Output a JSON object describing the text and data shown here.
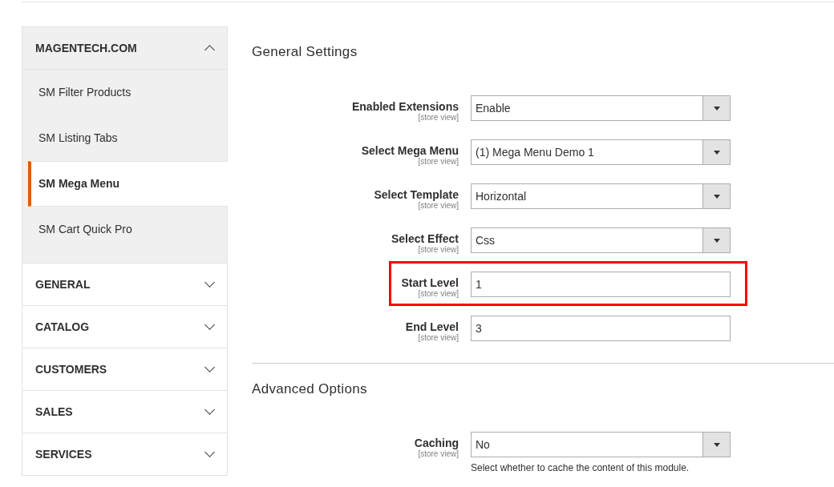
{
  "sidebar": {
    "groups": [
      {
        "label": "MAGENTECH.COM",
        "expanded": true,
        "children": [
          {
            "label": "SM Filter Products",
            "selected": false
          },
          {
            "label": "SM Listing Tabs",
            "selected": false
          },
          {
            "label": "SM Mega Menu",
            "selected": true
          },
          {
            "label": "SM Cart Quick Pro",
            "selected": false
          }
        ]
      },
      {
        "label": "GENERAL",
        "expanded": false
      },
      {
        "label": "CATALOG",
        "expanded": false
      },
      {
        "label": "CUSTOMERS",
        "expanded": false
      },
      {
        "label": "SALES",
        "expanded": false
      },
      {
        "label": "SERVICES",
        "expanded": false
      }
    ]
  },
  "sections": [
    {
      "title": "General Settings",
      "fields": [
        {
          "kind": "select",
          "label": "Enabled Extensions",
          "scope": "[store view]",
          "value": "Enable",
          "highlighted": false
        },
        {
          "kind": "select",
          "label": "Select Mega Menu",
          "scope": "[store view]",
          "value": "(1) Mega Menu Demo 1",
          "highlighted": false
        },
        {
          "kind": "select",
          "label": "Select Template",
          "scope": "[store view]",
          "value": "Horizontal",
          "highlighted": false
        },
        {
          "kind": "select",
          "label": "Select Effect",
          "scope": "[store view]",
          "value": "Css",
          "highlighted": false
        },
        {
          "kind": "text",
          "label": "Start Level",
          "scope": "[store view]",
          "value": "1",
          "highlighted": true
        },
        {
          "kind": "text",
          "label": "End Level",
          "scope": "[store view]",
          "value": "3",
          "highlighted": false
        }
      ]
    },
    {
      "title": "Advanced Options",
      "fields": [
        {
          "kind": "select",
          "label": "Caching",
          "scope": "[store view]",
          "value": "No",
          "note": "Select whether to cache the content of this module.",
          "highlighted": false
        }
      ]
    }
  ]
}
